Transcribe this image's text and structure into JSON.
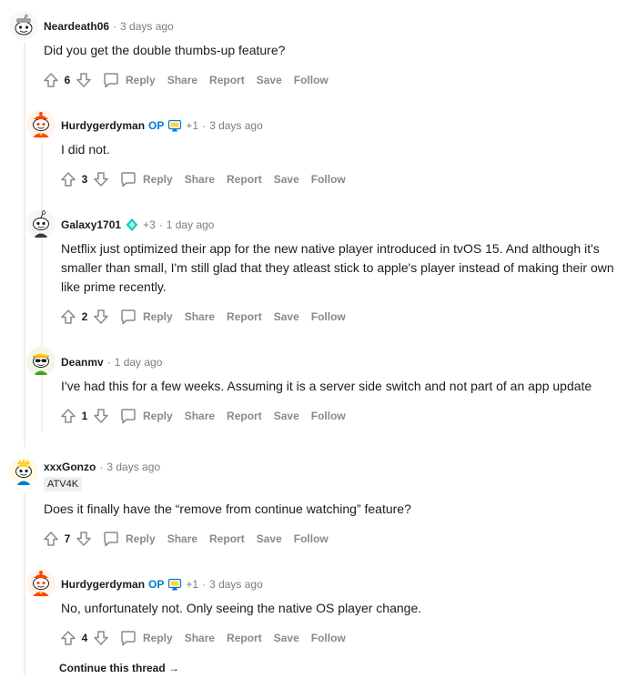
{
  "thread": {
    "continue_label": "Continue this thread →"
  },
  "comments": [
    {
      "author": "Neardeath06",
      "op": "",
      "karma": "",
      "time": "3 days ago",
      "flair": "",
      "body": "Did you get the double thumbs-up feature?",
      "score": "6",
      "actions": [
        "Reply",
        "Share",
        "Report",
        "Save",
        "Follow"
      ],
      "avatar": "snoo-gray"
    },
    {
      "author": "Hurdygerdyman",
      "op": "OP",
      "karma": "+1",
      "time": "3 days ago",
      "flair": "",
      "body": "I did not.",
      "score": "3",
      "actions": [
        "Reply",
        "Share",
        "Report",
        "Save",
        "Follow"
      ],
      "avatar": "snoo-red"
    },
    {
      "author": "Galaxy1701",
      "op": "",
      "karma": "+3",
      "time": "1 day ago",
      "flair": "",
      "body": "Netflix just optimized their app for the new native player introduced in tvOS 15. And although it's smaller than small, I'm still glad that they atleast stick to apple's player instead of making their own like prime recently.",
      "score": "2",
      "actions": [
        "Reply",
        "Share",
        "Report",
        "Save",
        "Follow"
      ],
      "avatar": "snoo-white"
    },
    {
      "author": "Deanmv",
      "op": "",
      "karma": "",
      "time": "1 day ago",
      "flair": "",
      "body": "I've had this for a few weeks. Assuming it is a server side switch and not part of an app update",
      "score": "1",
      "actions": [
        "Reply",
        "Share",
        "Report",
        "Save",
        "Follow"
      ],
      "avatar": "snoo-green"
    },
    {
      "author": "xxxGonzo",
      "op": "",
      "karma": "",
      "time": "3 days ago",
      "flair": "ATV4K",
      "body": "Does it finally have the “remove from continue watching” feature?",
      "score": "7",
      "actions": [
        "Reply",
        "Share",
        "Report",
        "Save",
        "Follow"
      ],
      "avatar": "snoo-yellow"
    },
    {
      "author": "Hurdygerdyman",
      "op": "OP",
      "karma": "+1",
      "time": "3 days ago",
      "flair": "",
      "body": "No, unfortunately not. Only seeing the native OS player change.",
      "score": "4",
      "actions": [
        "Reply",
        "Share",
        "Report",
        "Save",
        "Follow"
      ],
      "avatar": "snoo-red"
    }
  ],
  "colors": {
    "op": "#0079d3",
    "meta": "#7c7c7c",
    "action": "#878a8c",
    "thread_line": "#edeff1"
  }
}
